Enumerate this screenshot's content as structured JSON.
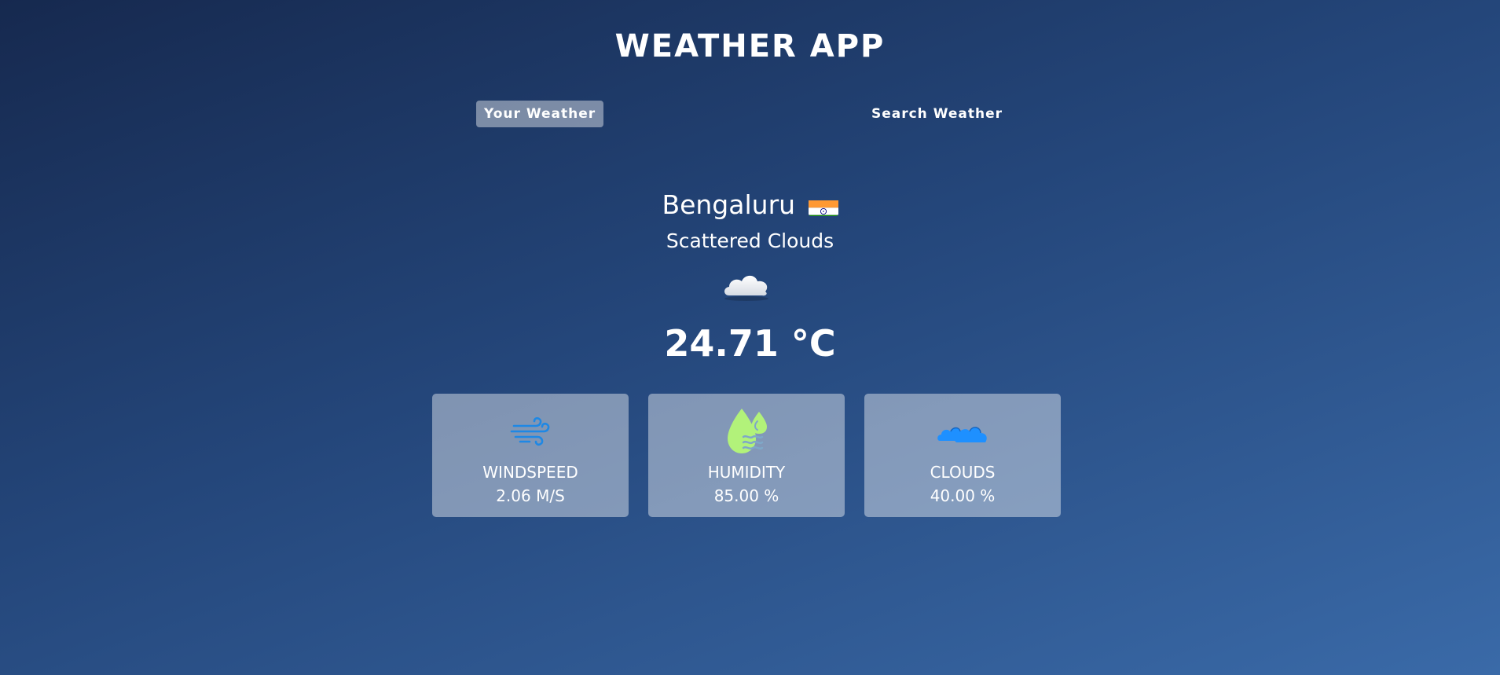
{
  "app": {
    "title": "WEATHER APP"
  },
  "tabs": [
    {
      "label": "Your Weather",
      "active": true
    },
    {
      "label": "Search Weather",
      "active": false
    }
  ],
  "location": {
    "city": "Bengaluru",
    "flag_icon": "india-flag-icon"
  },
  "weather": {
    "description": "Scattered Clouds",
    "icon": "cloud-icon",
    "temperature": "24.71 °C"
  },
  "stats": [
    {
      "label": "WINDSPEED",
      "value": "2.06 M/S",
      "icon": "wind-icon",
      "icon_color": "#1e88e5"
    },
    {
      "label": "HUMIDITY",
      "value": "85.00 %",
      "icon": "humidity-icon",
      "icon_color": "#b2f27a"
    },
    {
      "label": "CLOUDS",
      "value": "40.00 %",
      "icon": "clouds-icon",
      "icon_color": "#1e90ff"
    }
  ],
  "colors": {
    "background_start": "#16294f",
    "background_end": "#3a6aa8",
    "card_background": "rgba(255,255,255,0.42)",
    "text": "#ffffff"
  }
}
